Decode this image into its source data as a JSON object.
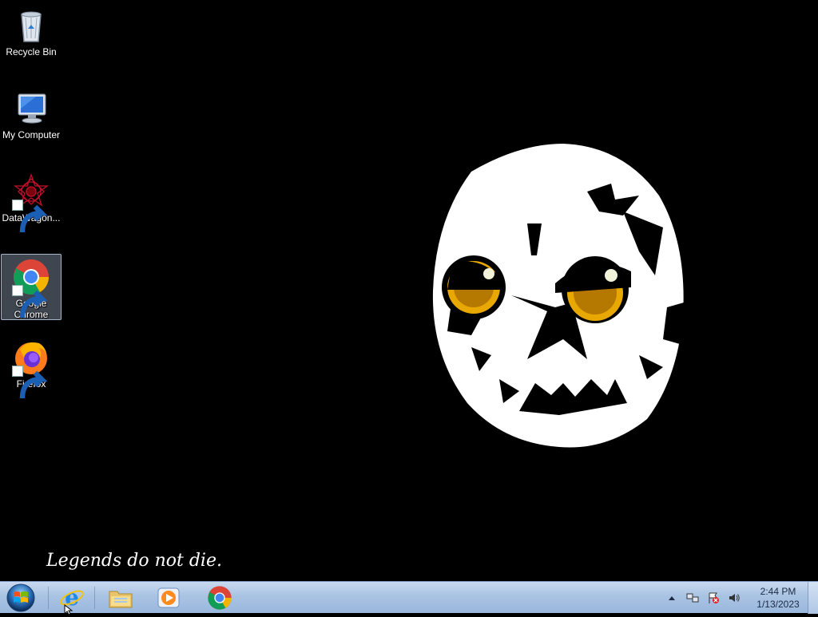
{
  "desktop": {
    "icons": [
      {
        "label": "Recycle Bin",
        "icon": "recycle-bin-icon"
      },
      {
        "label": "My Computer",
        "icon": "computer-icon"
      },
      {
        "label": "DataWagon...",
        "icon": "datawagon-icon"
      },
      {
        "label": "Google Chrome",
        "icon": "chrome-icon",
        "selected": true
      },
      {
        "label": "Firefox",
        "icon": "firefox-icon"
      }
    ],
    "tagline": "Legends do not die."
  },
  "taskbar": {
    "start_icon": "windows-start-icon",
    "pinned": [
      {
        "name": "Internet Explorer",
        "icon": "internet-explorer-icon"
      },
      {
        "name": "Windows Explorer",
        "icon": "folder-icon"
      },
      {
        "name": "Windows Media Player",
        "icon": "media-player-icon"
      },
      {
        "name": "Google Chrome",
        "icon": "chrome-icon"
      }
    ],
    "tray": {
      "icons": [
        "show-hidden-icons-icon",
        "network-icon",
        "action-center-flag-icon",
        "volume-icon"
      ],
      "time": "2:44 PM",
      "date": "1/13/2023"
    }
  },
  "colors": {
    "desktop_bg": "#000000",
    "taskbar_top": "#c9daf0",
    "taskbar_bottom": "#9ab7dd",
    "owl_eye": "#e8a800"
  }
}
